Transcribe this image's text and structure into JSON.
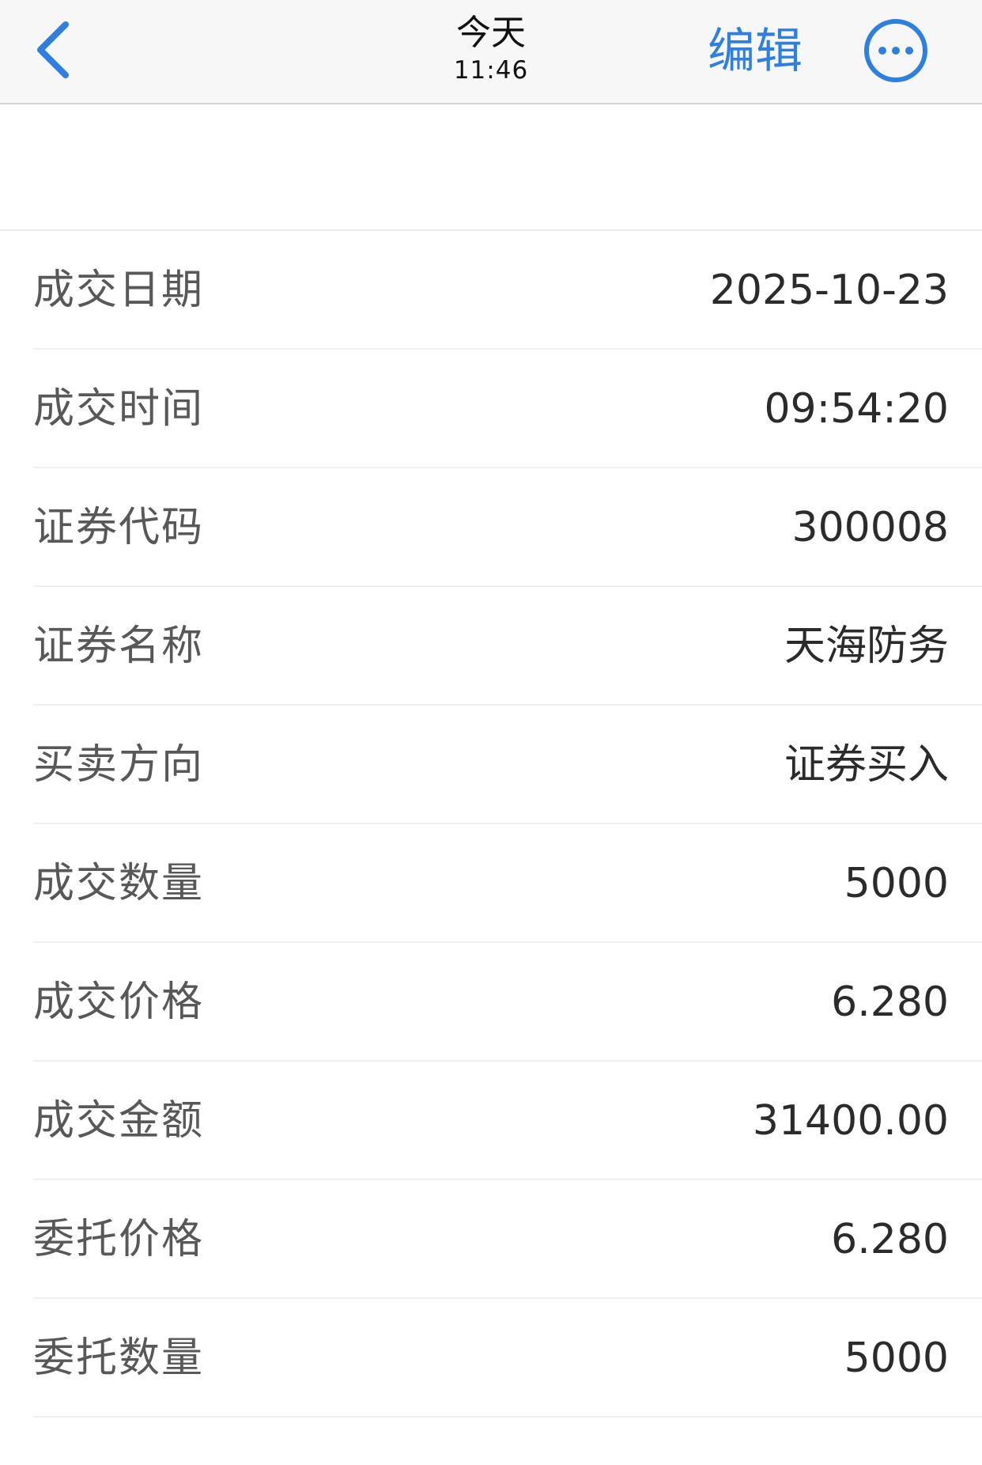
{
  "nav": {
    "title": "今天",
    "subtitle": "11:46",
    "edit_label": "编辑",
    "back_icon": "chevron-left-icon",
    "more_icon": "more-icon",
    "accent": "#2f7fe0"
  },
  "rows": [
    {
      "label": "成交日期",
      "value": "2025-10-23"
    },
    {
      "label": "成交时间",
      "value": "09:54:20"
    },
    {
      "label": "证券代码",
      "value": "300008"
    },
    {
      "label": "证券名称",
      "value": "天海防务"
    },
    {
      "label": "买卖方向",
      "value": "证券买入"
    },
    {
      "label": "成交数量",
      "value": "5000"
    },
    {
      "label": "成交价格",
      "value": "6.280"
    },
    {
      "label": "成交金额",
      "value": "31400.00"
    },
    {
      "label": "委托价格",
      "value": "6.280"
    },
    {
      "label": "委托数量",
      "value": "5000"
    }
  ]
}
